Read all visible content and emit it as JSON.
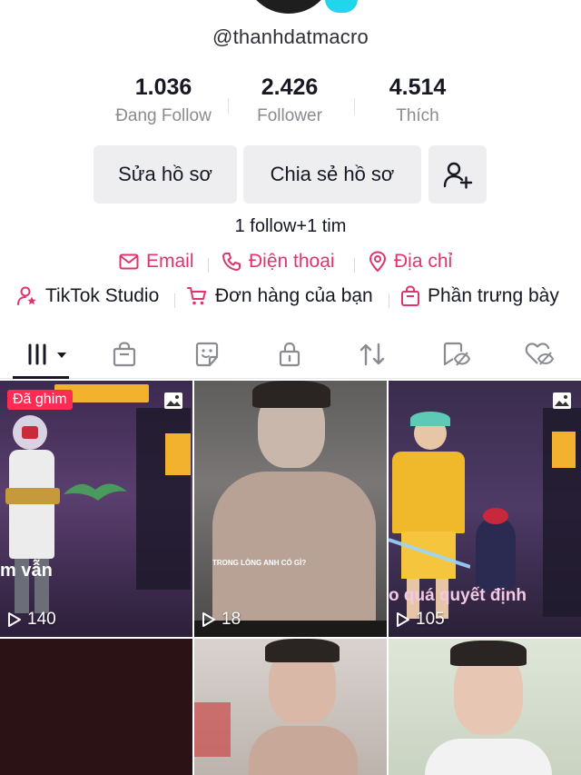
{
  "profile": {
    "username": "@thanhdatmacro",
    "bio": "1 follow+1 tim"
  },
  "stats": [
    {
      "value": "1.036",
      "label": "Đang Follow"
    },
    {
      "value": "2.426",
      "label": "Follower"
    },
    {
      "value": "4.514",
      "label": "Thích"
    }
  ],
  "actions": {
    "edit_profile": "Sửa hồ sơ",
    "share_profile": "Chia sẻ hồ sơ"
  },
  "contacts": {
    "email": "Email",
    "phone": "Điện thoại",
    "address": "Địa chỉ"
  },
  "links": {
    "studio": "TikTok Studio",
    "orders": "Đơn hàng của bạn",
    "showcase": "Phần trưng bày"
  },
  "tabs": [
    "videos-tab",
    "shop-tab",
    "sticker-tab",
    "private-tab",
    "repost-tab",
    "favorites-tab",
    "liked-tab"
  ],
  "videos": [
    {
      "views": "140",
      "pinned_label": "Đã ghim",
      "caption": "m vẫn",
      "type": "photo"
    },
    {
      "views": "18",
      "caption": "TRONG LÒNG ANH CÓ GÌ?",
      "type": "video"
    },
    {
      "views": "105",
      "caption": "o quá quyết định",
      "type": "photo"
    }
  ],
  "colors": {
    "accent": "#e0346c",
    "pinned": "#fe2c55",
    "button_bg": "#eeeef0",
    "text": "#161823",
    "muted": "#8a8b91"
  }
}
